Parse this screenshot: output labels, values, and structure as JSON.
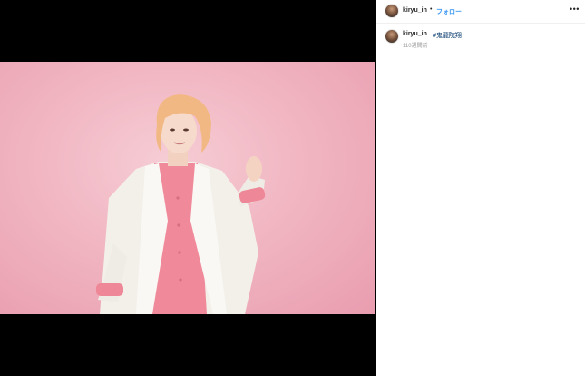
{
  "post": {
    "username": "kiryu_in",
    "separator": "•",
    "follow_label": "フォロー",
    "more_icon": "•••",
    "caption_hashtag": "#鬼龍院翔",
    "timestamp": "110週間前"
  },
  "colors": {
    "link_blue": "#3897f0",
    "hashtag": "#003569",
    "photo_bg": "#f1b6c2"
  }
}
